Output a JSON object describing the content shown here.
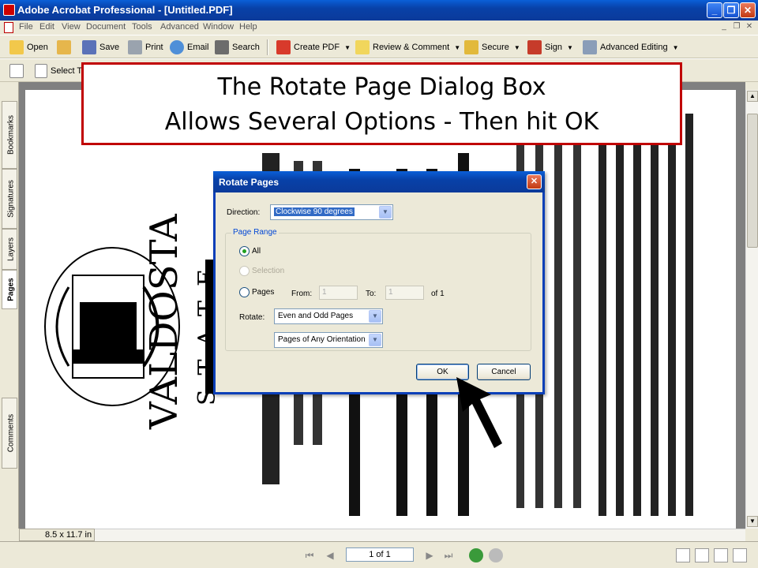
{
  "window": {
    "title": "Adobe Acrobat Professional - [Untitled.PDF]"
  },
  "menu": [
    "File",
    "Edit",
    "View",
    "Document",
    "Tools",
    "Advanced",
    "Window",
    "Help"
  ],
  "toolbar1": {
    "open": "Open",
    "save": "Save",
    "print": "Print",
    "email": "Email",
    "search": "Search",
    "create_pdf": "Create PDF",
    "review": "Review & Comment",
    "secure": "Secure",
    "sign": "Sign",
    "advanced": "Advanced Editing"
  },
  "toolbar2": {
    "select": "Select T"
  },
  "side_tabs": [
    "Bookmarks",
    "Signatures",
    "Layers",
    "Pages",
    "Comments"
  ],
  "page_size": "8.5 x 11.7 in",
  "status": {
    "page_field": "1 of 1"
  },
  "callout": {
    "line1": "The Rotate Page Dialog Box",
    "line2": "Allows Several Options - Then hit OK"
  },
  "dialog": {
    "title": "Rotate Pages",
    "direction_label": "Direction:",
    "direction_value": "Clockwise 90 degrees",
    "page_range_label": "Page Range",
    "all_label": "All",
    "selection_label": "Selection",
    "pages_label": "Pages",
    "from_label": "From:",
    "from_value": "1",
    "to_label": "To:",
    "to_value": "1",
    "of_label": "of 1",
    "rotate_label": "Rotate:",
    "rotate_value1": "Even and Odd Pages",
    "rotate_value2": "Pages of Any Orientation",
    "ok": "OK",
    "cancel": "Cancel"
  },
  "colors": {
    "accent": "#0b3fb8",
    "callout_border": "#c00000"
  }
}
